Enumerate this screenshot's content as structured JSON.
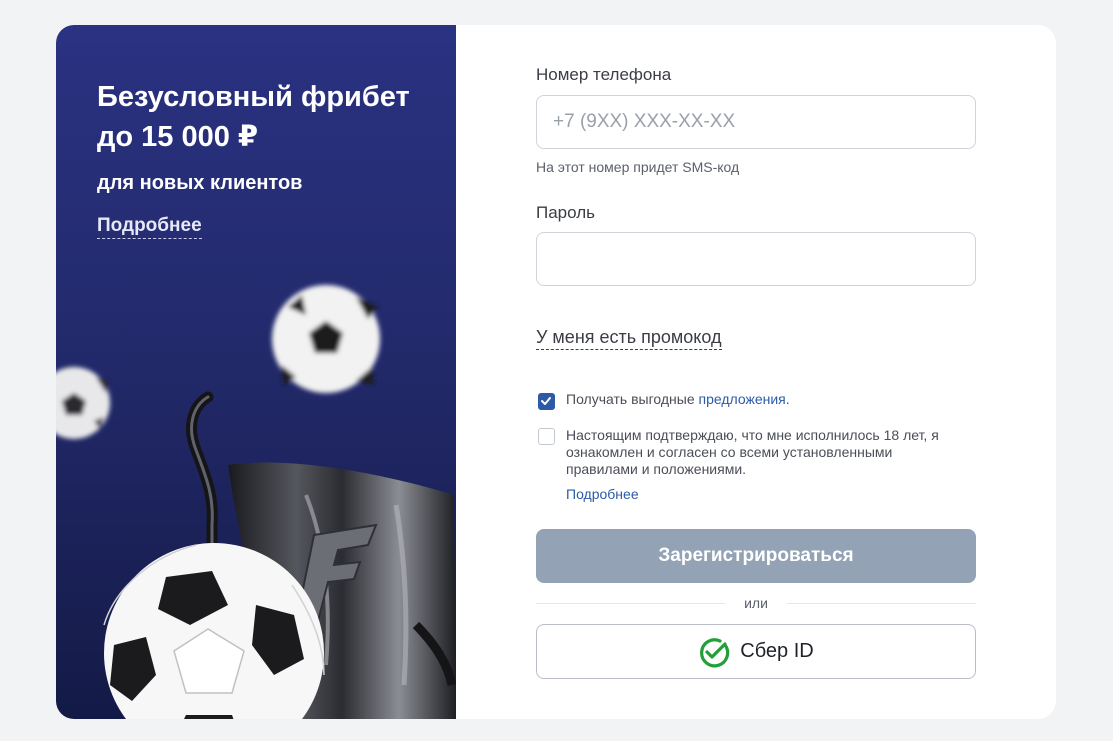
{
  "promo": {
    "title": "Безусловный фрибет до 15 000 ₽",
    "subtitle": "для новых клиентов",
    "more_link": "Подробнее"
  },
  "form": {
    "phone_label": "Номер телефона",
    "phone_placeholder": "+7 (9XX) XXX-XX-XX",
    "phone_hint": "На этот номер придет SMS-код",
    "password_label": "Пароль",
    "promo_code_link": "У меня есть промокод",
    "offers_checkbox": {
      "checked": true,
      "text_prefix": "Получать выгодные ",
      "link": "предложения",
      "text_suffix": "."
    },
    "age_checkbox": {
      "checked": false,
      "text": "Настоящим подтверждаю, что мне исполнилось 18 лет, я ознакомлен и согласен со всеми установленными правилами и положениями.",
      "more_link": "Подробнее"
    },
    "register_button": "Зарегистрироваться",
    "or_text": "или",
    "sber_button": "Сбер ID"
  },
  "colors": {
    "promo_bg": "#2a3282",
    "accent_blue": "#2c5aa8",
    "disabled_button": "#94a2b5",
    "sber_green": "#21a038"
  },
  "icons": [
    "soccer-ball-icon",
    "trophy-cup-icon",
    "check-icon",
    "sber-logo-icon"
  ]
}
